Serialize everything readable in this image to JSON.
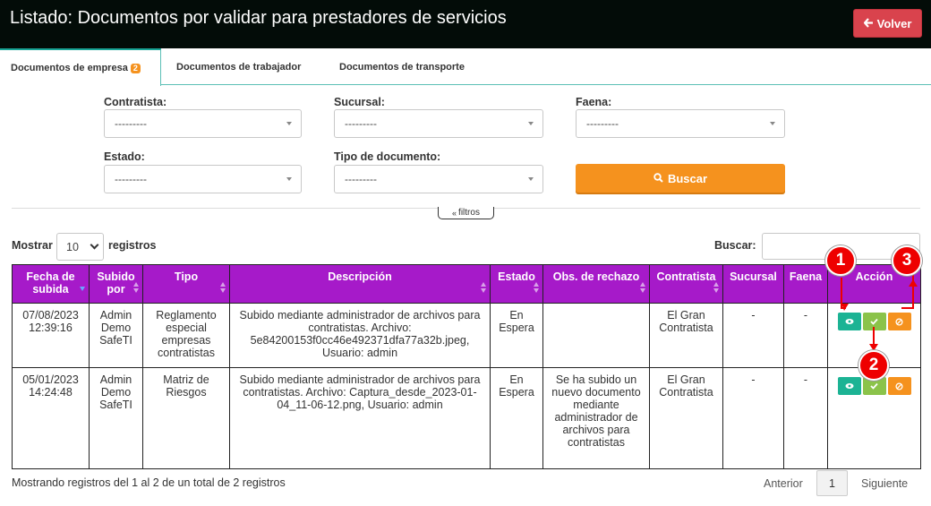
{
  "page": {
    "title": "Listado: Documentos por validar para prestadores de servicios",
    "back_button": "Volver"
  },
  "tabs": [
    {
      "label": "Documentos de empresa",
      "badge": "2"
    },
    {
      "label": "Documentos de trabajador"
    },
    {
      "label": "Documentos de transporte"
    }
  ],
  "filters": {
    "contratista": {
      "label": "Contratista:",
      "value": "---------"
    },
    "sucursal": {
      "label": "Sucursal:",
      "value": "---------"
    },
    "faena": {
      "label": "Faena:",
      "value": "---------"
    },
    "estado": {
      "label": "Estado:",
      "value": "---------"
    },
    "tipo_documento": {
      "label": "Tipo de documento:",
      "value": "---------"
    },
    "search_button": "Buscar",
    "toggle_label": "filtros"
  },
  "table_controls": {
    "show_label": "Mostrar",
    "page_length": "10",
    "records_label": "registros",
    "search_label": "Buscar:",
    "search_value": ""
  },
  "table": {
    "columns": [
      "Fecha de subida",
      "Subido por",
      "Tipo",
      "Descripción",
      "Estado",
      "Obs. de rechazo",
      "Contratista",
      "Sucursal",
      "Faena",
      "Acción"
    ],
    "rows": [
      {
        "fecha": "07/08/2023 12:39:16",
        "subido_por": "Admin Demo SafeTI",
        "tipo": "Reglamento especial empresas contratistas",
        "descripcion": "Subido mediante administrador de archivos para contratistas. Archivo: 5e84200153f0cc46e492371dfa77a32b.jpeg, Usuario: admin",
        "estado": "En Espera",
        "obs_rechazo": "",
        "contratista": "El Gran Contratista",
        "sucursal": "-",
        "faena": "-"
      },
      {
        "fecha": "05/01/2023 14:24:48",
        "subido_por": "Admin Demo SafeTI",
        "tipo": "Matriz de Riesgos",
        "descripcion": "Subido mediante administrador de archivos para contratistas. Archivo: Captura_desde_2023-01-04_11-06-12.png, Usuario: admin",
        "estado": "En Espera",
        "obs_rechazo": "Se ha subido un nuevo documento mediante administrador de archivos para contratistas",
        "contratista": "El Gran Contratista",
        "sucursal": "-",
        "faena": "-"
      }
    ]
  },
  "footer": {
    "info": "Mostrando registros del 1 al 2 de un total de 2 registros",
    "prev": "Anterior",
    "page": "1",
    "next": "Siguiente"
  },
  "callouts": [
    "1",
    "2",
    "3"
  ],
  "colors": {
    "header_bg": "#030c08",
    "table_header": "#a61ac9",
    "accent_orange": "#f5921e",
    "danger": "#d9434d",
    "view_button": "#1cb394",
    "approve_button": "#8bc34a",
    "callout_red": "#ee0000"
  }
}
